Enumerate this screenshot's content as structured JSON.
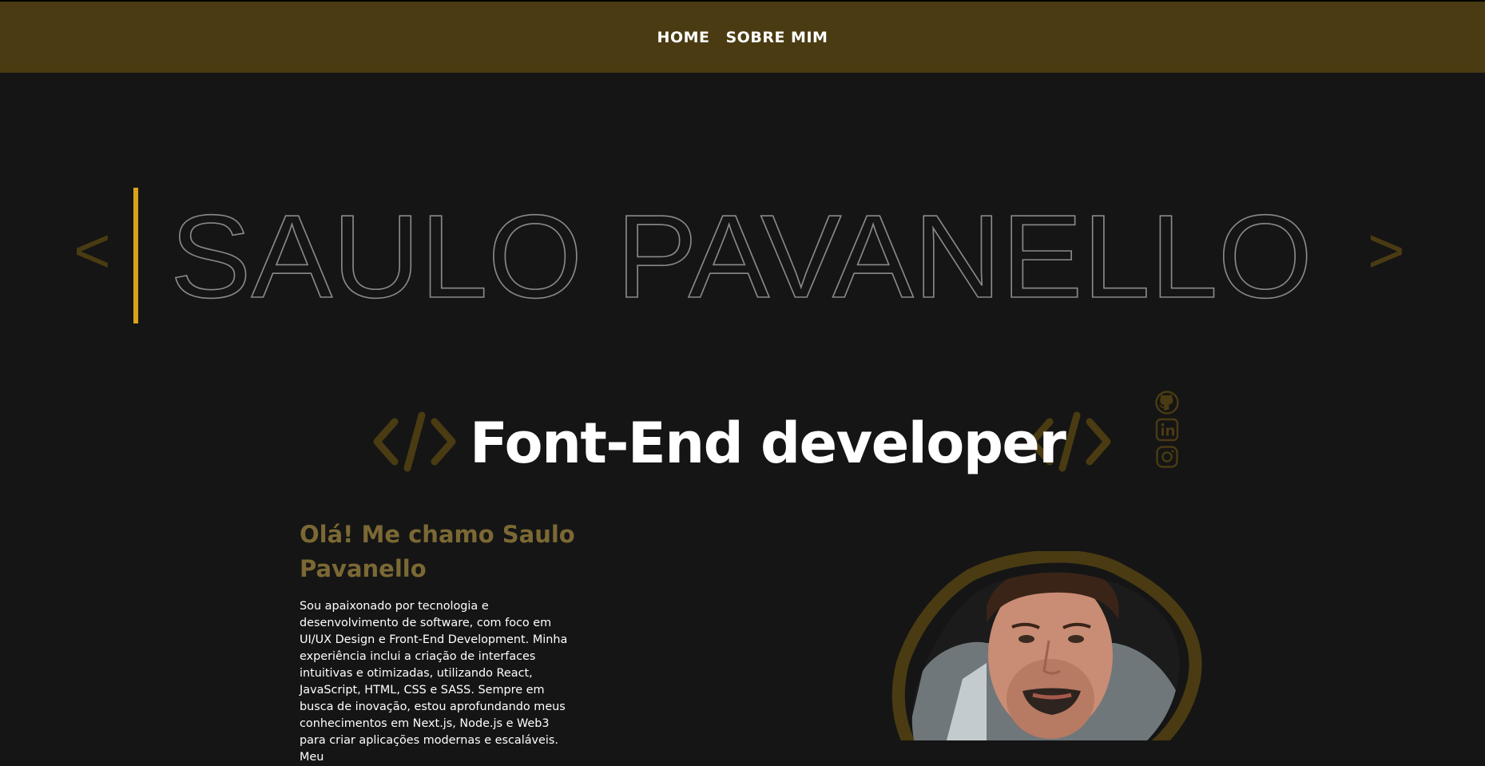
{
  "nav": {
    "links": [
      {
        "label": "HOME"
      },
      {
        "label": "SOBRE MIM"
      }
    ]
  },
  "hero": {
    "name": "SAULO PAVANELLO",
    "left_chevron": "<",
    "right_chevron": ">"
  },
  "role": {
    "title": "Font-End developer",
    "tag_icon": "code-tag-icon"
  },
  "social": [
    "github-icon",
    "linkedin-icon",
    "instagram-icon"
  ],
  "about": {
    "title": "Olá! Me chamo Saulo Pavanello",
    "text": "Sou apaixonado por tecnologia e desenvolvimento de software, com foco em UI/UX Design e Front-End Development. Minha experiência inclui a criação de interfaces intuitivas e otimizadas, utilizando React, JavaScript, HTML, CSS e SASS. Sempre em busca de inovação, estou aprofundando meus conhecimentos em Next.js, Node.js e Web3 para criar aplicações modernas e escaláveis. Meu"
  },
  "colors": {
    "background": "#151515",
    "navbar": "#4a3b12",
    "accent": "#d9a21b",
    "muted_gold": "#4a3b12",
    "title_gold": "#7b6834"
  }
}
